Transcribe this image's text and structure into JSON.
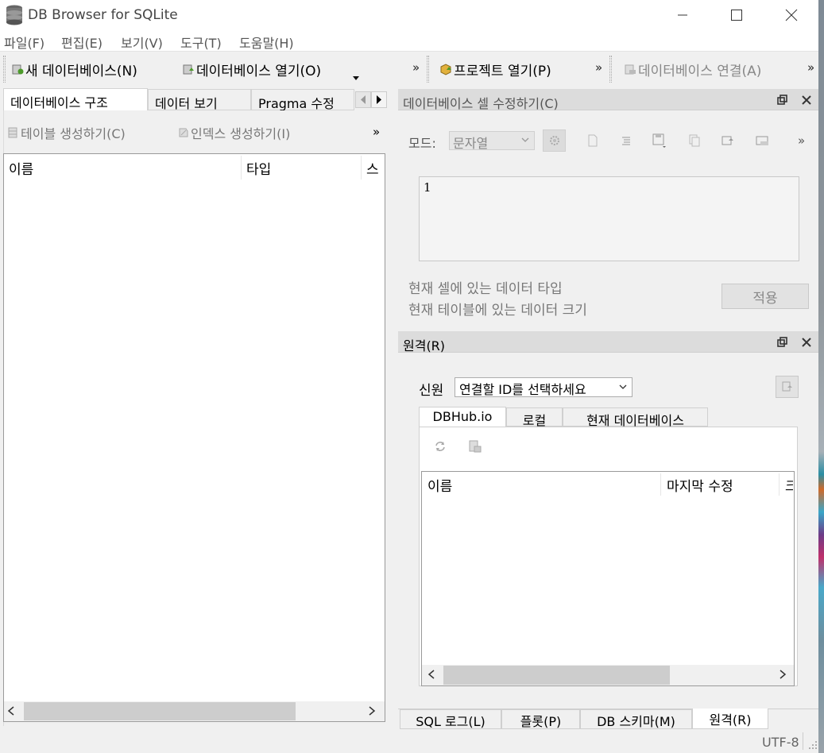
{
  "window": {
    "title": "DB Browser for SQLite",
    "controls": {
      "minimize": "—",
      "maximize": "☐",
      "close": "✕"
    }
  },
  "menu": [
    "파일(F)",
    "편집(E)",
    "보기(V)",
    "도구(T)",
    "도움말(H)"
  ],
  "toolbar": {
    "new_db": "새 데이터베이스(N)",
    "open_db": "데이터베이스 열기(O)",
    "open_project": "프로젝트 열기(P)",
    "attach_db": "데이터베이스 연결(A)",
    "overflow": "»"
  },
  "left_tabs": [
    "데이터베이스 구조",
    "데이터 보기",
    "Pragma 수정"
  ],
  "structure": {
    "create_table": "테이블 생성하기(C)",
    "create_index": "인덱스 생성하기(I)",
    "overflow": "»",
    "columns": [
      "이름",
      "타입",
      "스키"
    ]
  },
  "edit_cell": {
    "title": "데이터베이스 셀 수정하기(C)",
    "mode_label": "모드:",
    "mode_value": "문자열",
    "overflow": "»",
    "content": "1",
    "type_info": "현재 셀에 있는 데이터 타입",
    "size_info": "현재 테이블에 있는 데이터 크기",
    "apply": "적용"
  },
  "remote": {
    "title": "원격(R)",
    "source_label": "신원",
    "source_value": "연결할 ID를 선택하세요",
    "tabs": [
      "DBHub.io",
      "로컬",
      "현재 데이터베이스"
    ],
    "columns": [
      "이름",
      "마지막 수정",
      "크"
    ]
  },
  "bottom_tabs": [
    "SQL 로그(L)",
    "플롯(P)",
    "DB 스키마(M)",
    "원격(R)"
  ],
  "status": {
    "encoding": "UTF-8"
  }
}
